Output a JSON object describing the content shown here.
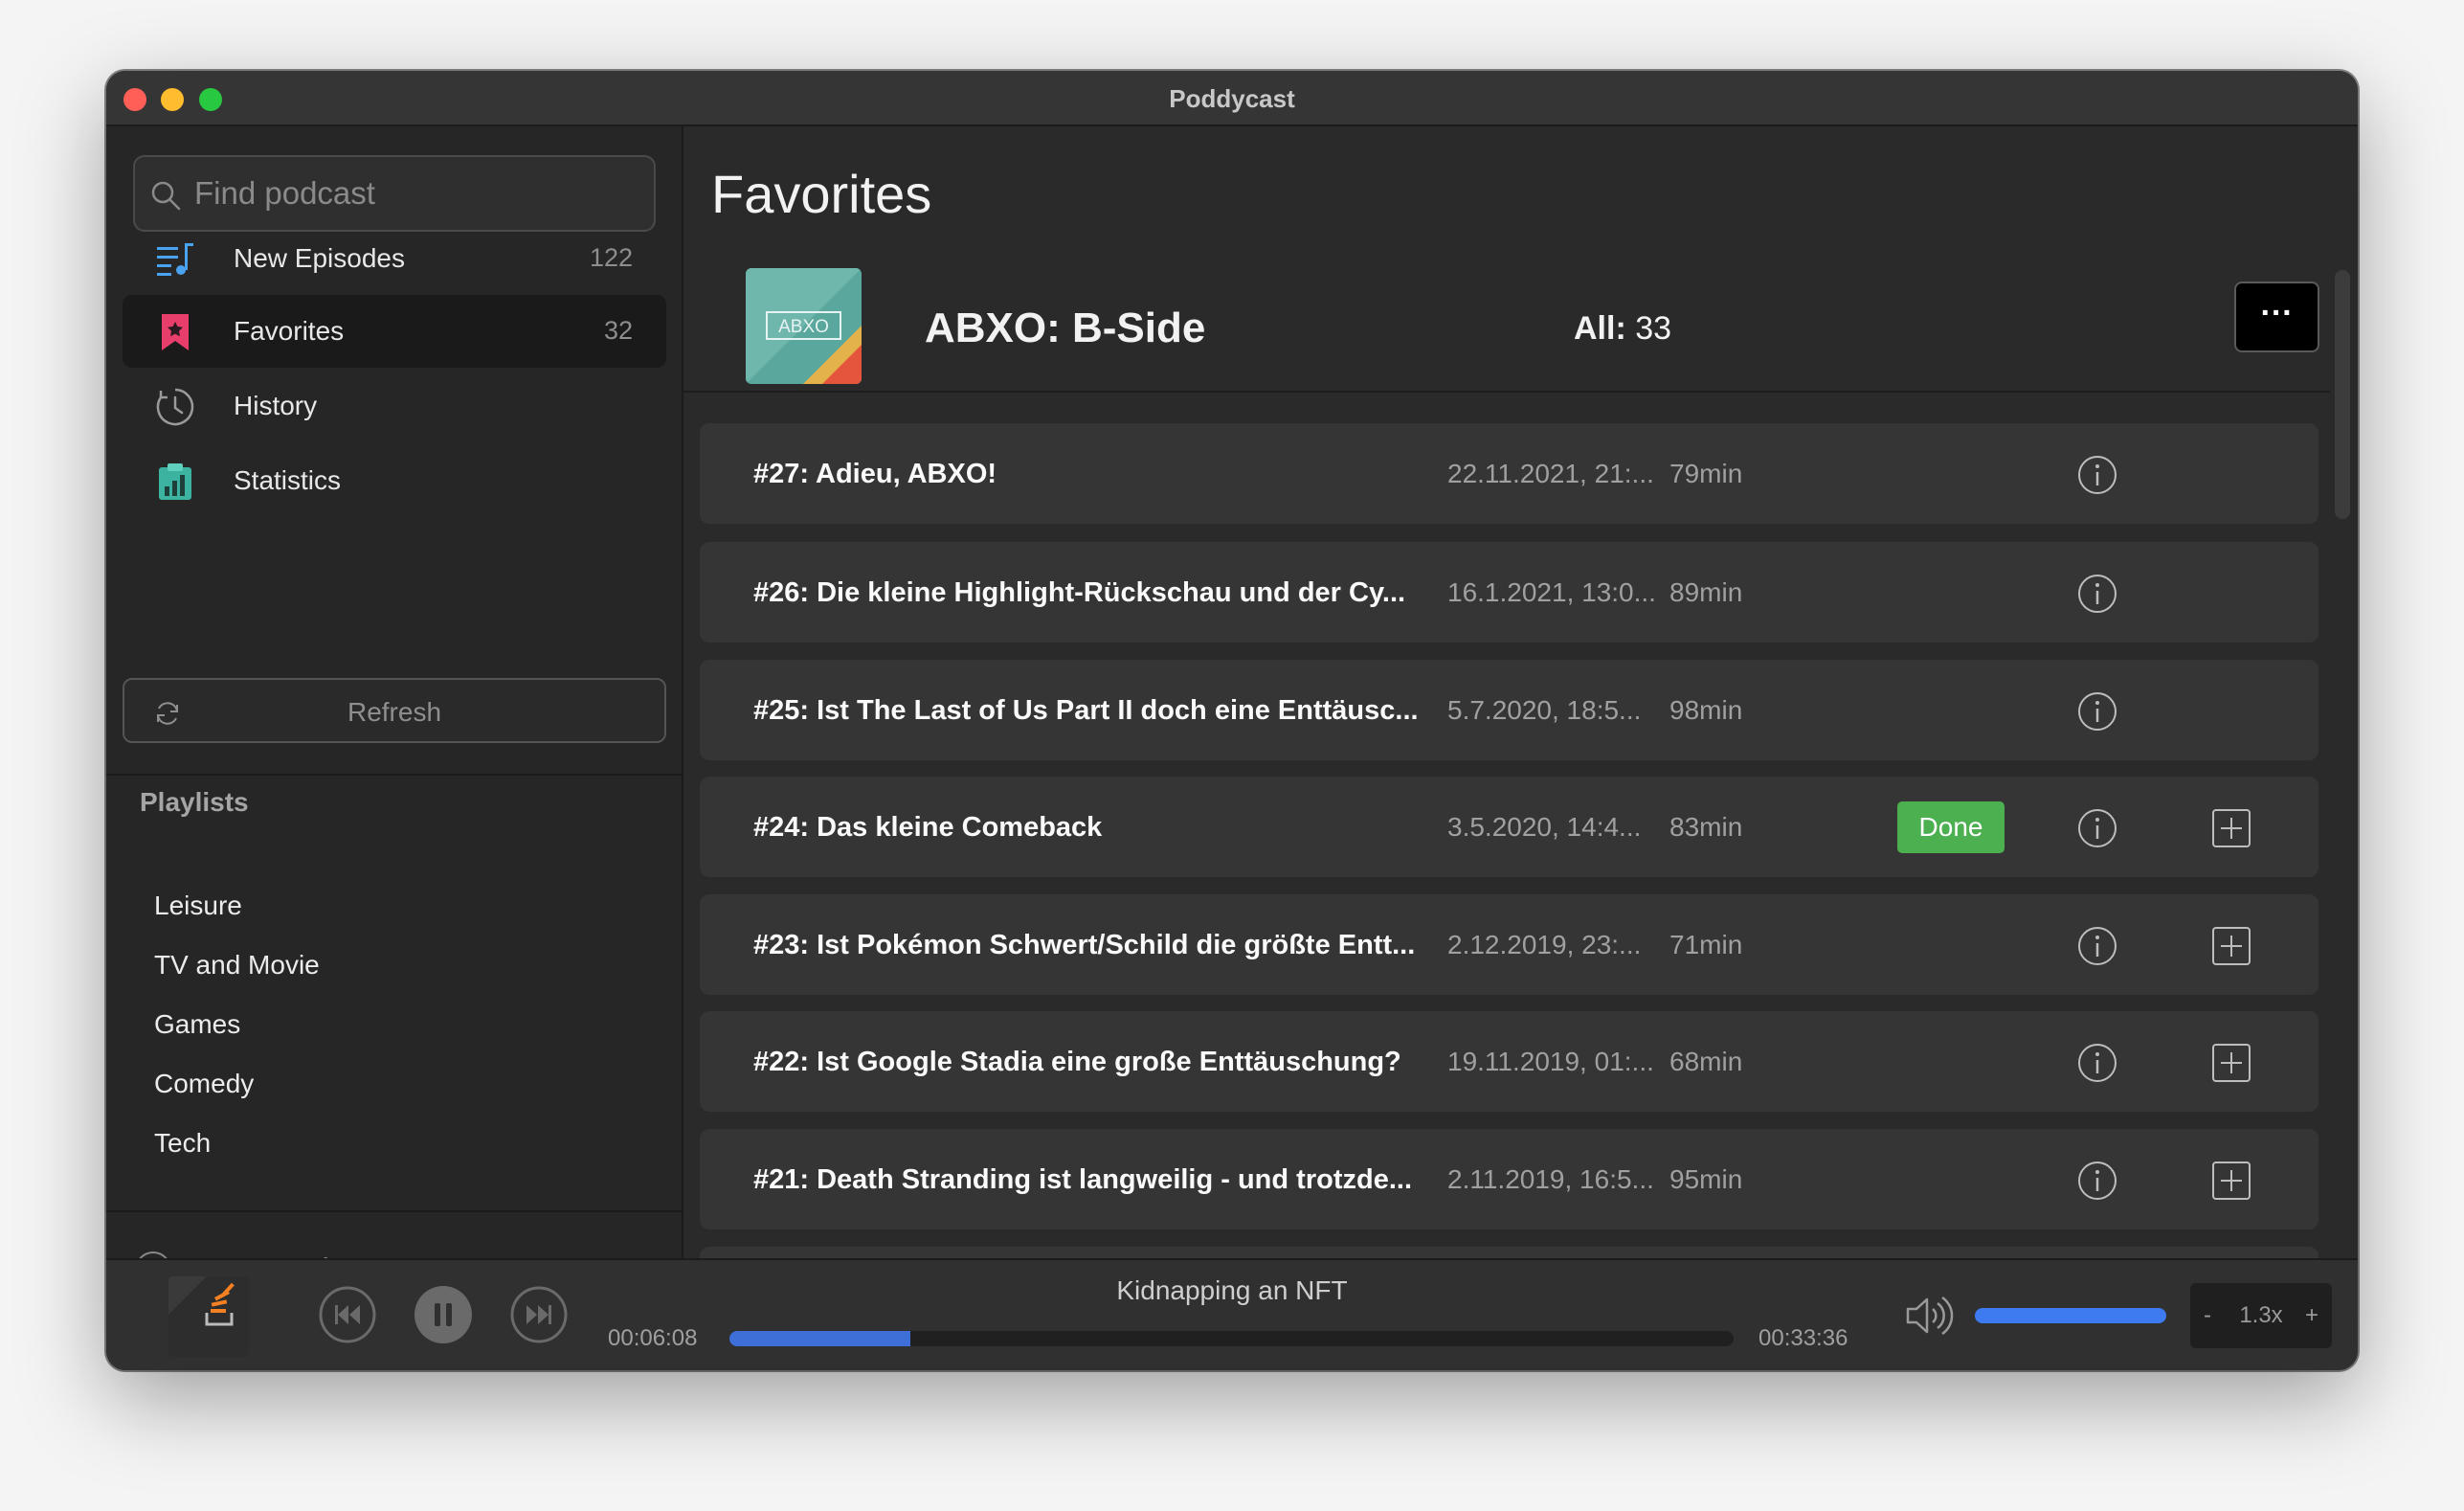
{
  "window": {
    "title": "Poddycast"
  },
  "search": {
    "placeholder": "Find podcast"
  },
  "sidebar": {
    "nav": [
      {
        "label": "New Episodes",
        "count": "122",
        "icon": "playlist-music-icon",
        "color": "#4aa3f0"
      },
      {
        "label": "Favorites",
        "count": "32",
        "icon": "bookmark-icon",
        "color": "#e83e6b"
      },
      {
        "label": "History",
        "count": "",
        "icon": "clock-history-icon",
        "color": "#9a9a9a"
      },
      {
        "label": "Statistics",
        "count": "",
        "icon": "statistics-clipboard-icon",
        "color": "#3bb3a0"
      }
    ],
    "refresh_label": "Refresh",
    "playlists_heading": "Playlists",
    "playlists": [
      "Leisure",
      "TV and Movie",
      "Games",
      "Comedy",
      "Tech"
    ],
    "new_list_label": "New List"
  },
  "main": {
    "page_title": "Favorites",
    "podcast": {
      "name": "ABXO: B-Side",
      "count_label": "All:",
      "count_value": "33",
      "art_text": "ABXO",
      "more_label": "···"
    },
    "episodes": [
      {
        "title": "#27: Adieu, ABXO!",
        "date": "22.11.2021, 21:...",
        "duration": "79min",
        "done": "",
        "addable": false
      },
      {
        "title": "#26: Die kleine Highlight-Rückschau und der Cy...",
        "date": "16.1.2021, 13:0...",
        "duration": "89min",
        "done": "",
        "addable": false
      },
      {
        "title": "#25: Ist The Last of Us Part II doch eine Enttäusc...",
        "date": "5.7.2020, 18:5...",
        "duration": "98min",
        "done": "",
        "addable": false
      },
      {
        "title": "#24: Das kleine Comeback",
        "date": "3.5.2020, 14:4...",
        "duration": "83min",
        "done": "Done",
        "addable": true
      },
      {
        "title": "#23: Ist Pokémon Schwert/Schild die größte Entt...",
        "date": "2.12.2019, 23:...",
        "duration": "71min",
        "done": "",
        "addable": true
      },
      {
        "title": "#22: Ist Google Stadia eine große Enttäuschung?",
        "date": "19.11.2019, 01:...",
        "duration": "68min",
        "done": "",
        "addable": true
      },
      {
        "title": "#21: Death Stranding ist langweilig - und trotzde...",
        "date": "2.11.2019, 16:5...",
        "duration": "95min",
        "done": "",
        "addable": true
      }
    ]
  },
  "player": {
    "track_title": "Kidnapping an NFT",
    "elapsed": "00:06:08",
    "total": "00:33:36",
    "progress": 0.18,
    "volume": 1.0,
    "speed": "1.3x",
    "speed_minus": "-",
    "speed_plus": "+",
    "art_caption": "The Stack Overflow Podcast"
  },
  "colors": {
    "accent_blue": "#3e6fd8",
    "done_green": "#4caf50",
    "favorites_pink": "#e83e6b"
  }
}
